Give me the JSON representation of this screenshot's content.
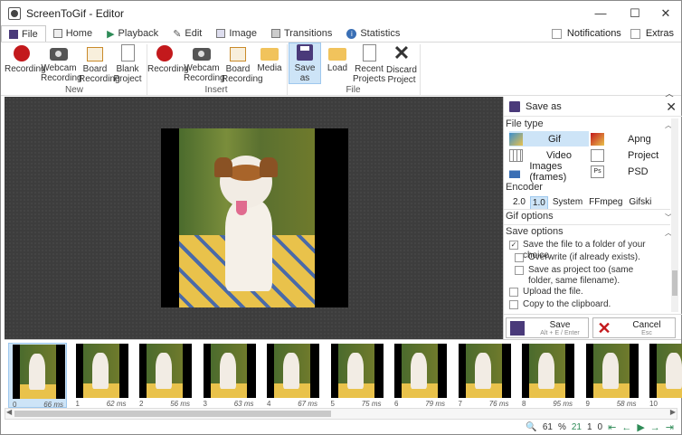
{
  "window": {
    "title": "ScreenToGif - Editor"
  },
  "tabs": [
    {
      "label": "File",
      "active": true
    },
    {
      "label": "Home"
    },
    {
      "label": "Playback"
    },
    {
      "label": "Edit"
    },
    {
      "label": "Image"
    },
    {
      "label": "Transitions"
    },
    {
      "label": "Statistics"
    }
  ],
  "tabs_right": {
    "notifications": "Notifications",
    "extras": "Extras"
  },
  "ribbon": {
    "groups": [
      {
        "label": "New",
        "buttons": [
          {
            "label": "Recording",
            "icon": "record-icon"
          },
          {
            "label": "Webcam Recording",
            "icon": "webcam-icon"
          },
          {
            "label": "Board Recording",
            "icon": "board-icon"
          },
          {
            "label": "Blank Project",
            "icon": "blank-project-icon"
          }
        ]
      },
      {
        "label": "Insert",
        "buttons": [
          {
            "label": "Recording",
            "icon": "record-icon"
          },
          {
            "label": "Webcam Recording",
            "icon": "webcam-icon"
          },
          {
            "label": "Board Recording",
            "icon": "board-icon"
          },
          {
            "label": "Media",
            "icon": "folder-icon"
          }
        ]
      },
      {
        "label": "File",
        "buttons": [
          {
            "label": "Save as",
            "icon": "save-icon",
            "selected": true
          },
          {
            "label": "Load",
            "icon": "folder-icon"
          },
          {
            "label": "Recent Projects",
            "icon": "recent-icon"
          },
          {
            "label": "Discard Project",
            "icon": "discard-icon"
          }
        ]
      }
    ]
  },
  "panel": {
    "title": "Save as",
    "file_type_label": "File type",
    "file_types": [
      {
        "label": "Gif",
        "selected": true
      },
      {
        "label": "Apng"
      },
      {
        "label": "Video"
      },
      {
        "label": "Project"
      },
      {
        "label": "Images (frames)"
      },
      {
        "label": "PSD"
      }
    ],
    "encoder_label": "Encoder",
    "encoders": [
      "2.0",
      "1.0",
      "System",
      "FFmpeg",
      "Gifski"
    ],
    "encoder_selected": "1.0",
    "gif_options_label": "Gif options",
    "save_options_label": "Save options",
    "options": [
      {
        "label": "Save the file to a folder of your choice.",
        "checked": true,
        "indent": 0
      },
      {
        "label": "Overwrite (if already exists).",
        "checked": false,
        "indent": 1
      },
      {
        "label": "Save as project too (same folder, same filename).",
        "checked": false,
        "indent": 1
      },
      {
        "label": "Upload the file.",
        "checked": false,
        "indent": 0
      },
      {
        "label": "Copy to the clipboard.",
        "checked": false,
        "indent": 0
      }
    ],
    "save_button": {
      "label": "Save",
      "shortcut": "Alt + E / Enter"
    },
    "cancel_button": {
      "label": "Cancel",
      "shortcut": "Esc"
    }
  },
  "frames": [
    {
      "index": "0",
      "delay": "66 ms",
      "selected": true
    },
    {
      "index": "1",
      "delay": "62 ms"
    },
    {
      "index": "2",
      "delay": "56 ms"
    },
    {
      "index": "3",
      "delay": "63 ms"
    },
    {
      "index": "4",
      "delay": "67 ms"
    },
    {
      "index": "5",
      "delay": "75 ms"
    },
    {
      "index": "6",
      "delay": "79 ms"
    },
    {
      "index": "7",
      "delay": "76 ms"
    },
    {
      "index": "8",
      "delay": "95 ms"
    },
    {
      "index": "9",
      "delay": "58 ms"
    },
    {
      "index": "10",
      "delay": ""
    }
  ],
  "status": {
    "zoom": "61",
    "zoom_unit": "%",
    "frame_count": "21",
    "selected_count": "1",
    "current_frame": "0"
  },
  "colors": {
    "accent": "#cde4f7",
    "record": "#c3191c",
    "save": "#4a3a7a",
    "nav": "#2e8b57"
  }
}
